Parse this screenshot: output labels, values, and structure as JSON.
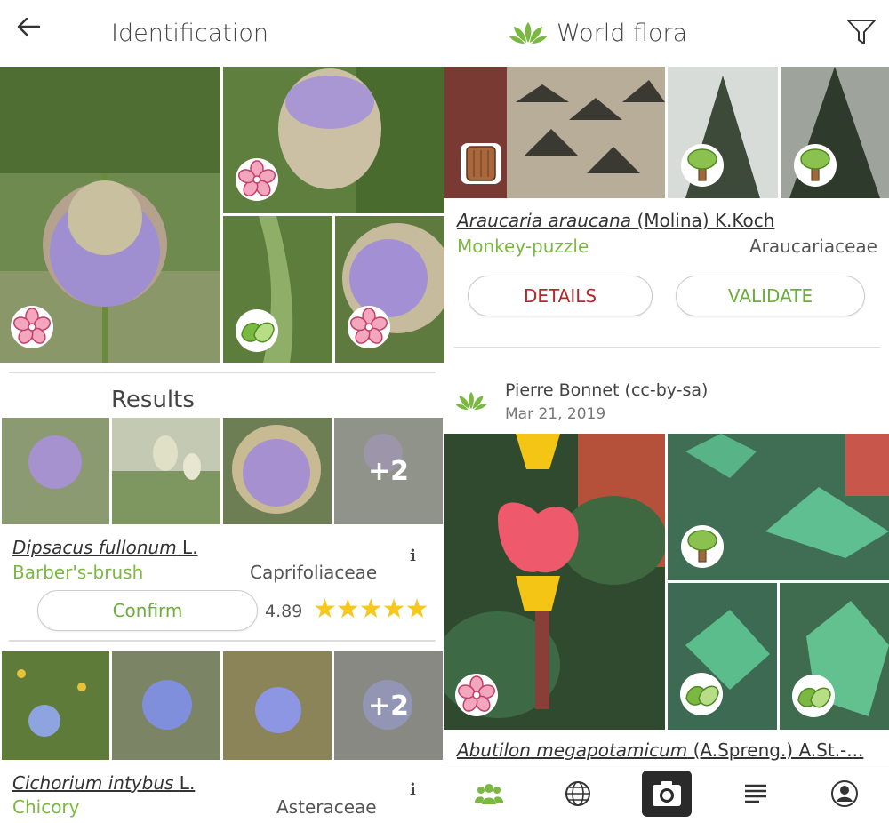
{
  "identification": {
    "header": {
      "title": "Identification"
    },
    "results_title": "Results",
    "results": [
      {
        "scientific_name": "Dipsacus fullonum",
        "author": "L.",
        "common_name": "Barber's-brush",
        "family": "Caprifoliaceae",
        "confirm_label": "Confirm",
        "score": "4.89",
        "stars": "★★★★★",
        "more_count": "+2"
      },
      {
        "scientific_name": "Cichorium intybus",
        "author": "L.",
        "common_name": "Chicory",
        "family": "Asteraceae",
        "more_count": "+2"
      }
    ]
  },
  "world_flora": {
    "header": {
      "title": "World flora"
    },
    "observations": [
      {
        "scientific_name": "Araucaria araucana",
        "author": "(Molina) K.Koch",
        "common_name": "Monkey-puzzle",
        "family": "Araucariaceae",
        "details_label": "DETAILS",
        "validate_label": "VALIDATE"
      },
      {
        "observer": "Pierre Bonnet (cc-by-sa)",
        "date": "Mar 21, 2019",
        "scientific_name": "Abutilon megapotamicum",
        "author": "(A.Spreng.) A.St.-..."
      }
    ]
  },
  "colors": {
    "brand_green": "#7bb842",
    "details_red": "#b8272d",
    "star_yellow": "#f6c81b"
  },
  "icons": [
    "back-arrow-icon",
    "leaf-logo-icon",
    "filter-icon",
    "flower-organ-icon",
    "leaf-organ-icon",
    "bark-organ-icon",
    "tree-habit-icon",
    "info-icon",
    "community-icon",
    "globe-icon",
    "camera-icon",
    "list-icon",
    "profile-icon"
  ]
}
